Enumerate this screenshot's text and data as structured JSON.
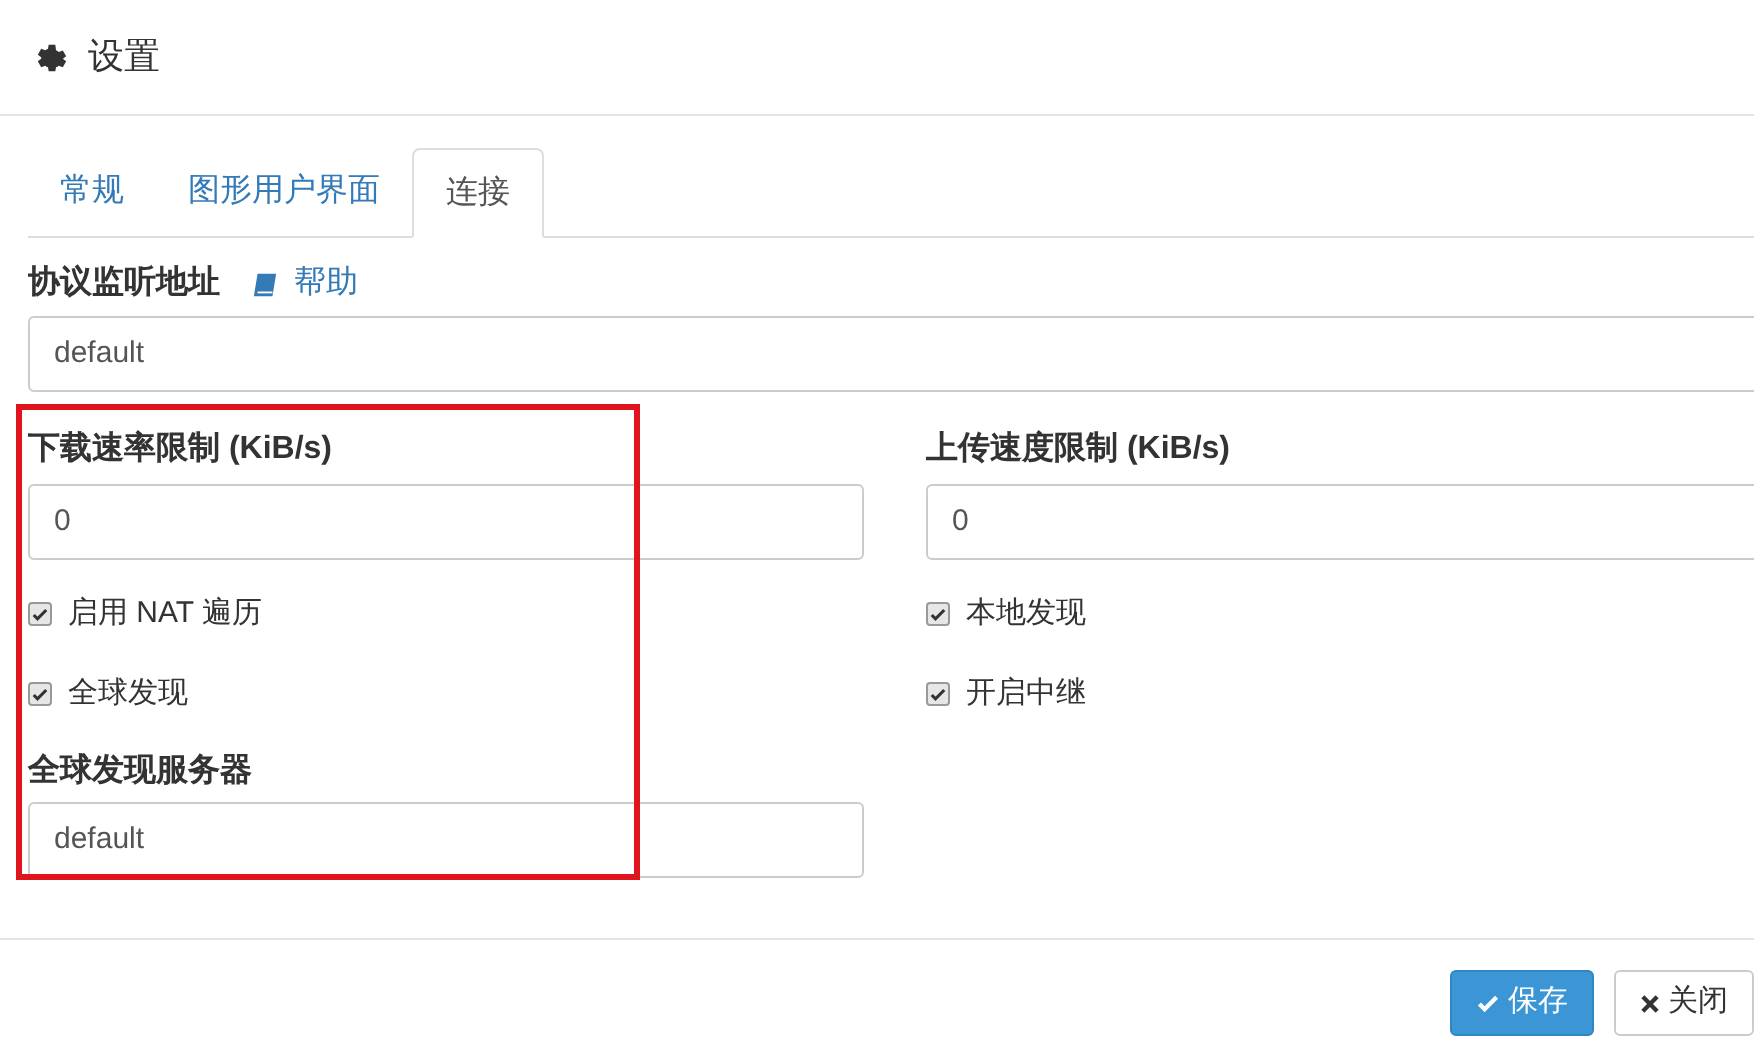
{
  "window": {
    "title": "设置"
  },
  "tabs": [
    {
      "label": "常规",
      "selected": false
    },
    {
      "label": "图形用户界面",
      "selected": false
    },
    {
      "label": "连接",
      "selected": true
    }
  ],
  "listen_address": {
    "label": "协议监听地址",
    "help": "帮助",
    "value": "default"
  },
  "columns": [
    {
      "rate": {
        "label": "下载速率限制 (KiB/s)",
        "value": "0"
      },
      "checks": [
        {
          "label": "启用 NAT 遍历",
          "checked": true
        },
        {
          "label": "全球发现",
          "checked": true
        }
      ],
      "server": {
        "label": "全球发现服务器",
        "value": "default"
      }
    },
    {
      "rate": {
        "label": "上传速度限制 (KiB/s)",
        "value": "0"
      },
      "checks": [
        {
          "label": "本地发现",
          "checked": true
        },
        {
          "label": "开启中继",
          "checked": true
        }
      ]
    }
  ],
  "buttons": [
    {
      "kind": "primary",
      "label": "保存"
    },
    {
      "kind": "default",
      "label": "关闭"
    }
  ]
}
